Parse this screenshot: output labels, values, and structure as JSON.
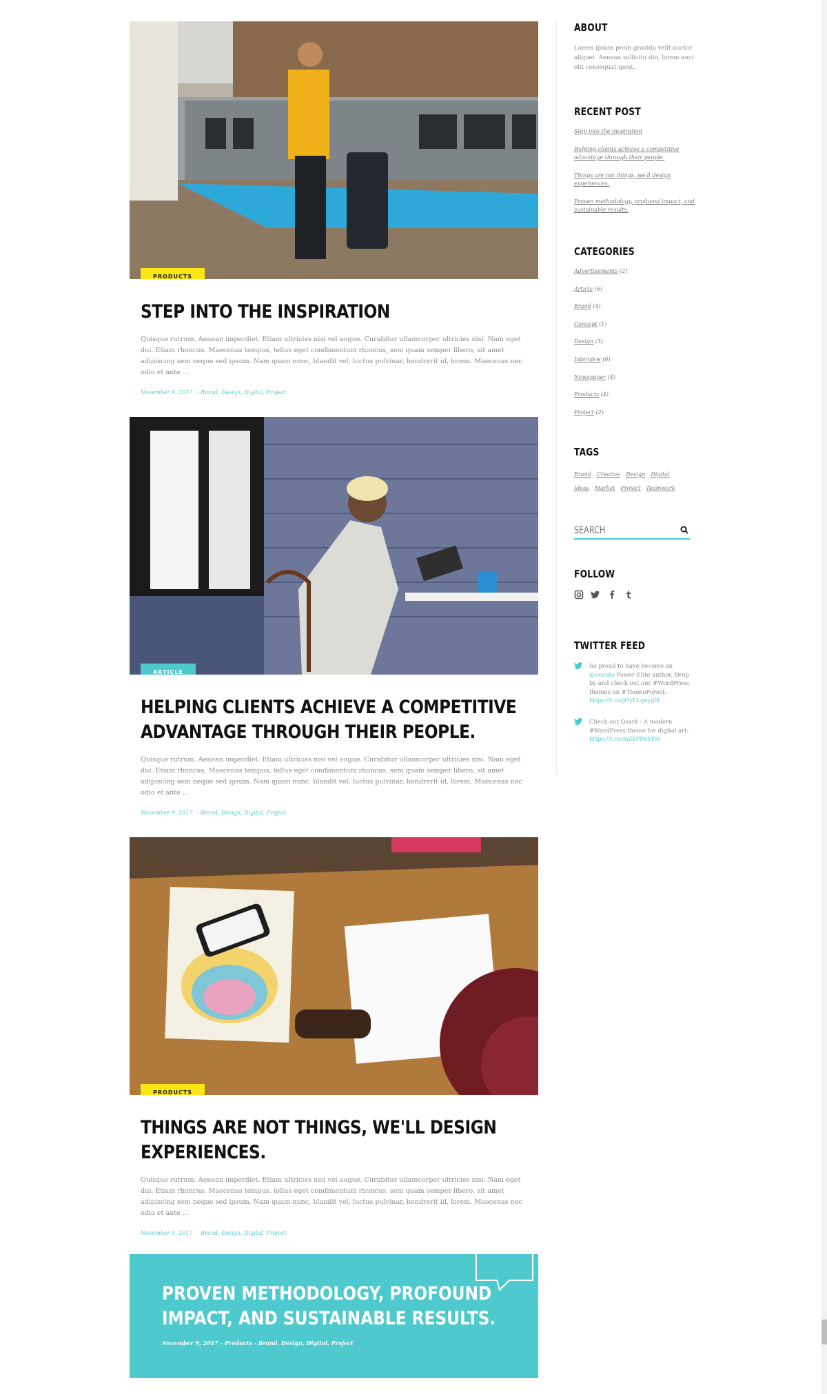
{
  "posts": [
    {
      "category": "Products",
      "title": "Step into the inspiration",
      "excerpt": "Quisque rutrum. Aenean imperdiet. Etiam ultricies nisi vel augue. Curabitur ullamcorper ultricies nisi. Nam eget dui. Etiam rhoncus. Maecenas tempus, tellus eget condimentum rhoncus, sem quam semper libero, sit amet adipiscing sem neque sed ipsum. Nam quam nunc, blandit vel, luctus pulvinar, hendrerit id, lorem. Maecenas nec odio et ante ...",
      "date": "November 9, 2017",
      "tags": "- Brand, Design, Digital, Project"
    },
    {
      "category": "Article",
      "title": "Helping clients achieve a competitive advantage through their people.",
      "excerpt": "Quisque rutrum. Aenean imperdiet. Etiam ultricies nisi vel augue. Curabitur ullamcorper ultricies nisi. Nam eget dui. Etiam rhoncus. Maecenas tempus, tellus eget condimentum rhoncus, sem quam semper libero, sit amet adipiscing sem neque sed ipsum. Nam quam nunc, blandit vel, luctus pulvinar, hendrerit id, lorem. Maecenas nec odio et ante ...",
      "date": "November 9, 2017",
      "tags": "- Brand, Design, Digital, Project"
    },
    {
      "category": "Products",
      "title": "Things are not things, we'll design experiences.",
      "excerpt": "Quisque rutrum. Aenean imperdiet. Etiam ultricies nisi vel augue. Curabitur ullamcorper ultricies nisi. Nam eget dui. Etiam rhoncus. Maecenas tempus, tellus eget condimentum rhoncus, sem quam semper libero, sit amet adipiscing sem neque sed ipsum. Nam quam nunc, blandit vel, luctus pulvinar, hendrerit id, lorem. Maecenas nec odio et ante ...",
      "date": "November 9, 2017",
      "tags": "- Brand, Design, Digital, Project"
    }
  ],
  "quote_post": {
    "title": "Proven methodology, profound impact, and sustainable results.",
    "date": "November 9, 2017",
    "category": "- Products",
    "tags": "- Brand, Design, Digital, Project"
  },
  "sidebar": {
    "about": {
      "heading": "About",
      "text": "Lorem ipsum proin gravida velit auctor aliquet. Aenean sollicitu din, lorem auci elit consequat ipsut."
    },
    "recent": {
      "heading": "Recent Post",
      "items": [
        "Step into the inspiration",
        "Helping clients achieve a competitive advantage through their people.",
        "Things are not things, we'll design experiences.",
        "Proven methodology, profound impact, and sustainable results."
      ]
    },
    "categories": {
      "heading": "Categories",
      "items": [
        {
          "name": "Advertisements",
          "count": "(2)"
        },
        {
          "name": "Article",
          "count": "(6)"
        },
        {
          "name": "Brand",
          "count": "(4)"
        },
        {
          "name": "Concept",
          "count": "(1)"
        },
        {
          "name": "Design",
          "count": "(3)"
        },
        {
          "name": "Interview",
          "count": "(6)"
        },
        {
          "name": "Newspaper",
          "count": "(4)"
        },
        {
          "name": "Products",
          "count": "(4)"
        },
        {
          "name": "Project",
          "count": "(2)"
        }
      ]
    },
    "tags": {
      "heading": "Tags",
      "items": [
        "Brand",
        "Creative",
        "Design",
        "Digital",
        "Ideas",
        "Market",
        "Project",
        "Teamwork"
      ]
    },
    "search": {
      "placeholder": "Search"
    },
    "follow": {
      "heading": "Follow",
      "icons": [
        "instagram-icon",
        "twitter-icon",
        "facebook-icon",
        "tumblr-icon"
      ]
    },
    "twitter": {
      "heading": "Twitter Feed",
      "tweets": [
        {
          "text": "So proud to have become an",
          "handle": "@envato",
          "text2": "Power Elite author. Drop by and check out our #WordPress themes on #ThemeForest:",
          "link": "https://t.co/jOyLLgeygN"
        },
        {
          "text": "Check out Qsark - A modern #WordPress theme for digital art:",
          "handle": "",
          "text2": "",
          "link": "https://t.co/mZkPPnYFi9"
        }
      ]
    }
  },
  "colors": {
    "accent": "#4ec9cd",
    "badge_yellow": "#f9e612"
  }
}
